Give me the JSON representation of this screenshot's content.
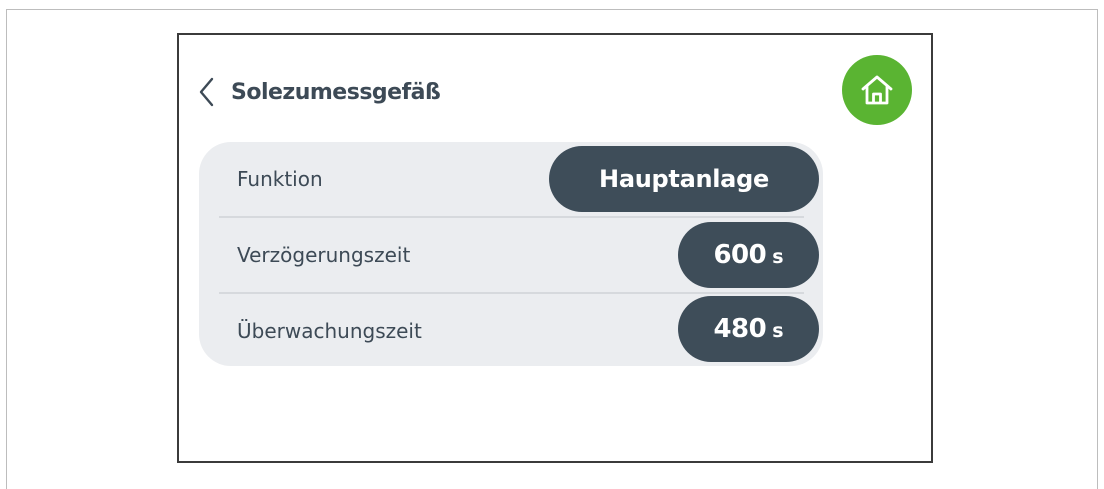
{
  "header": {
    "title": "Solezumessgefäß",
    "back_icon": "chevron-left-icon",
    "home_icon": "home-icon"
  },
  "colors": {
    "accent_green": "#5ab432",
    "pill_background": "#3e4d59",
    "panel_background": "#ebedf0",
    "text_dark": "#3d4a56"
  },
  "settings": {
    "rows": [
      {
        "label": "Funktion",
        "value": "Hauptanlage",
        "unit": ""
      },
      {
        "label": "Verzögerungszeit",
        "value": "600",
        "unit": "s"
      },
      {
        "label": "Überwachungszeit",
        "value": "480",
        "unit": "s"
      }
    ]
  }
}
